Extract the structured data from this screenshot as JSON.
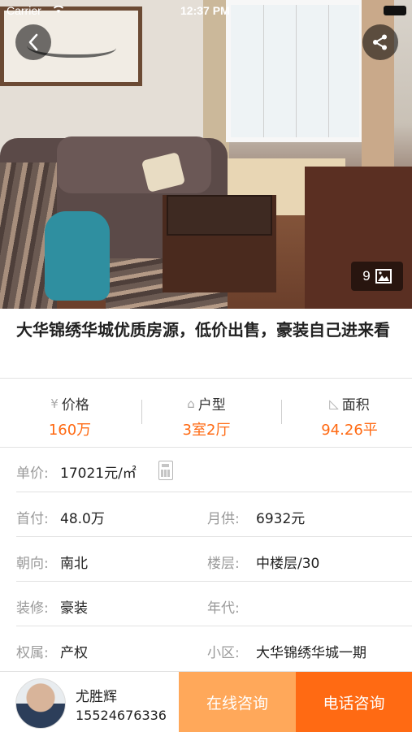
{
  "status_bar": {
    "carrier": "Carrier",
    "time": "12:37 PM"
  },
  "gallery": {
    "photo_count": "9"
  },
  "listing": {
    "title": "大华锦绣华城优质房源，低价出售，豪装自己进来看"
  },
  "stats": [
    {
      "icon": "yen-icon",
      "icon_glyph": "¥",
      "label": "价格",
      "value": "160万"
    },
    {
      "icon": "house-icon",
      "icon_glyph": "⌂",
      "label": "户型",
      "value": "3室2厅"
    },
    {
      "icon": "area-icon",
      "icon_glyph": "◺",
      "label": "面积",
      "value": "94.26平"
    }
  ],
  "details": {
    "unit_price": {
      "label": "单价:",
      "value": "17021元/㎡"
    },
    "down_payment": {
      "label": "首付:",
      "value": "48.0万"
    },
    "monthly": {
      "label": "月供:",
      "value": "6932元"
    },
    "orientation": {
      "label": "朝向:",
      "value": "南北"
    },
    "floor": {
      "label": "楼层:",
      "value": "中楼层/30"
    },
    "decoration": {
      "label": "装修:",
      "value": "豪装"
    },
    "year": {
      "label": "年代:",
      "value": ""
    },
    "ownership": {
      "label": "权属:",
      "value": "产权"
    },
    "community": {
      "label": "小区:",
      "value": "大华锦绣华城一期"
    }
  },
  "agent": {
    "name": "尤胜辉",
    "phone": "15524676336"
  },
  "actions": {
    "online_label": "在线咨询",
    "phone_label": "电话咨询"
  },
  "colors": {
    "accent": "#ff6a13",
    "accent_light": "#ffa85a"
  }
}
